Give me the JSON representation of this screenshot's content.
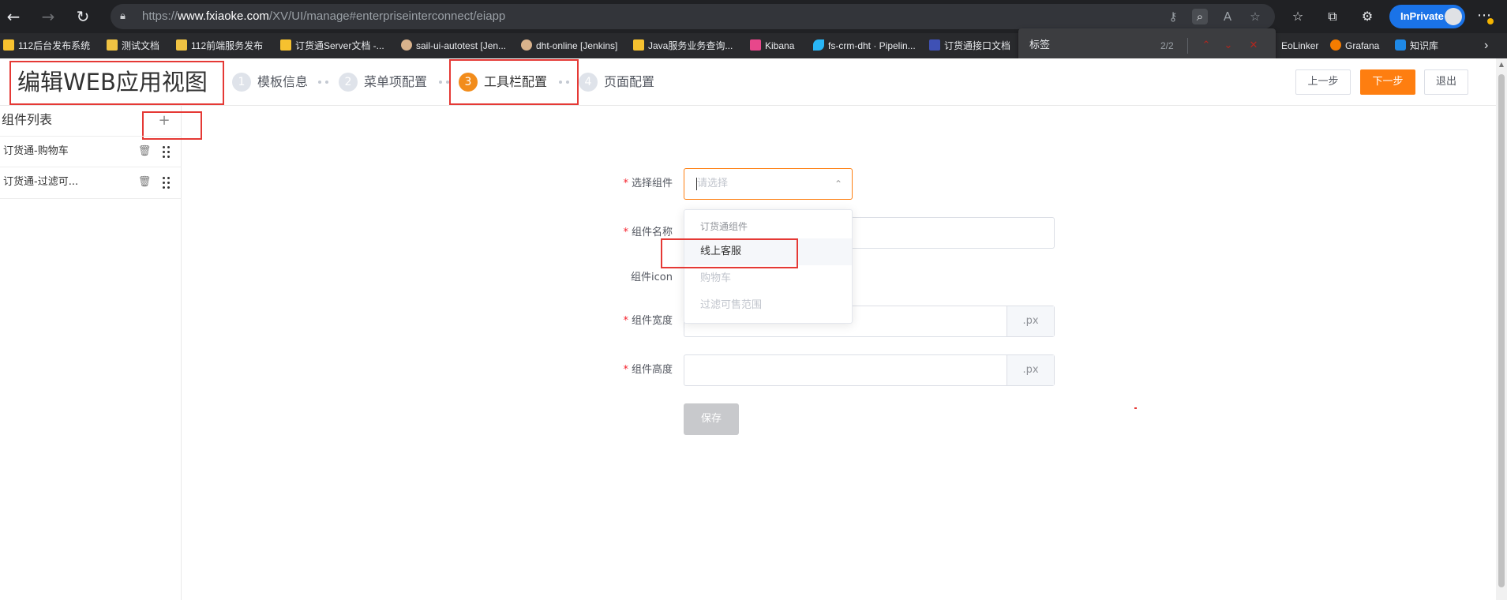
{
  "browser": {
    "url_prefix": "https://",
    "url_host": "www.fxiaoke.com",
    "url_path": "/XV/UI/manage#enterpriseinterconnect/eiapp",
    "inprivate_label": "InPrivate",
    "bookmarks": [
      "112后台发布系统",
      "测试文档",
      "112前端服务发布",
      "订货通Server文档 -...",
      "sail-ui-autotest [Jen...",
      "dht-online [Jenkins]",
      "Java服务业务查询...",
      "Kibana",
      "fs-crm-dht · Pipelin...",
      "订货通接口文档",
      "EoLinker",
      "Grafana",
      "知识库"
    ],
    "find": {
      "query": "标签",
      "count": "2/2"
    }
  },
  "header": {
    "title": "编辑WEB应用视图",
    "steps": [
      {
        "num": "1",
        "label": "模板信息"
      },
      {
        "num": "2",
        "label": "菜单项配置"
      },
      {
        "num": "3",
        "label": "工具栏配置"
      },
      {
        "num": "4",
        "label": "页面配置"
      }
    ],
    "prev_label": "上一步",
    "next_label": "下一步",
    "exit_label": "退出"
  },
  "sidebar": {
    "title": "组件列表",
    "add_symbol": "+",
    "items": [
      {
        "label": "订货通-购物车"
      },
      {
        "label": "订货通-过滤可..."
      }
    ]
  },
  "form": {
    "component": {
      "label": "选择组件",
      "placeholder": "请选择"
    },
    "name": {
      "label": "组件名称"
    },
    "icon": {
      "label": "组件icon"
    },
    "width": {
      "label": "组件宽度",
      "unit": ".px"
    },
    "height": {
      "label": "组件高度",
      "unit": ".px"
    },
    "save_label": "保存"
  },
  "dropdown": {
    "group": "订货通组件",
    "options": [
      {
        "label": "线上客服",
        "state": "hover"
      },
      {
        "label": "购物车",
        "state": "disabled"
      },
      {
        "label": "过滤可售范围",
        "state": "disabled"
      }
    ]
  },
  "colors": {
    "accent": "#fe7e10",
    "step_active": "#f28c1b",
    "annotation": "#e53935"
  }
}
